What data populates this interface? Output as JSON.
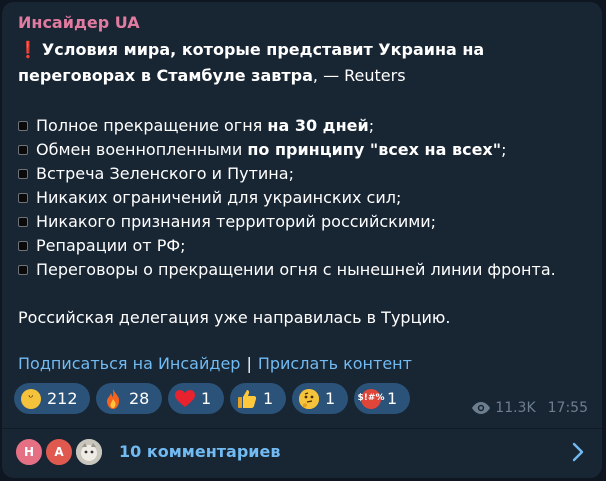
{
  "post": {
    "channel_name": "Инсайдер UA",
    "headline_bold": "Условия мира, которые представит Украина на",
    "headline_bold_2": "переговорах в Стамбуле завтра",
    "headline_suffix": ", — Reuters",
    "items": [
      {
        "text": "Полное прекращение огня ",
        "bold": "на 30 дней",
        "after": ";"
      },
      {
        "text": "Обмен военнопленными ",
        "bold": "по принципу \"всех на всех\"",
        "after": ";"
      },
      {
        "text": "Встреча Зеленского и Путина;",
        "bold": "",
        "after": ""
      },
      {
        "text": "Никаких ограничений для украинских сил;",
        "bold": "",
        "after": ""
      },
      {
        "text": "Никакого признания территорий российскими;",
        "bold": "",
        "after": ""
      },
      {
        "text": "Репарации от РФ;",
        "bold": "",
        "after": ""
      },
      {
        "text": "Переговоры о прекращении огня с нынешней линии фронта.",
        "bold": "",
        "after": ""
      }
    ],
    "closing": "Российская делегация уже направилась в Турцию.",
    "link_subscribe": "Подписаться на Инсайдер",
    "link_separator": "|",
    "link_submit": "Прислать контент"
  },
  "reactions": [
    {
      "emoji": "grinning-face",
      "glyph": "😁",
      "count": "212"
    },
    {
      "emoji": "fire",
      "glyph": "🔥",
      "count": "28"
    },
    {
      "emoji": "red-heart",
      "glyph": "❤",
      "count": "1"
    },
    {
      "emoji": "thumbs-up",
      "glyph": "👍",
      "count": "1"
    },
    {
      "emoji": "thinking-face",
      "glyph": "🤔",
      "count": "1"
    },
    {
      "emoji": "face-with-symbols",
      "glyph": "$!#%",
      "count": "1"
    }
  ],
  "meta": {
    "views": "11.3K",
    "time": "17:55",
    "views_icon": "eye-icon"
  },
  "comments": {
    "label": "10 комментариев",
    "avatars": [
      {
        "initial": "Н",
        "color": "#e57084"
      },
      {
        "initial": "А",
        "color": "#e0594f"
      },
      {
        "initial": "",
        "color": "#b9b7b0"
      }
    ],
    "chevron_icon": "chevron-right-icon"
  },
  "colors": {
    "background": "#0e1621",
    "bubble": "#182533",
    "channel_name": "#e27ba0",
    "link": "#71baf2",
    "reaction_pill": "#2b5278",
    "meta": "#6d7f8f"
  }
}
